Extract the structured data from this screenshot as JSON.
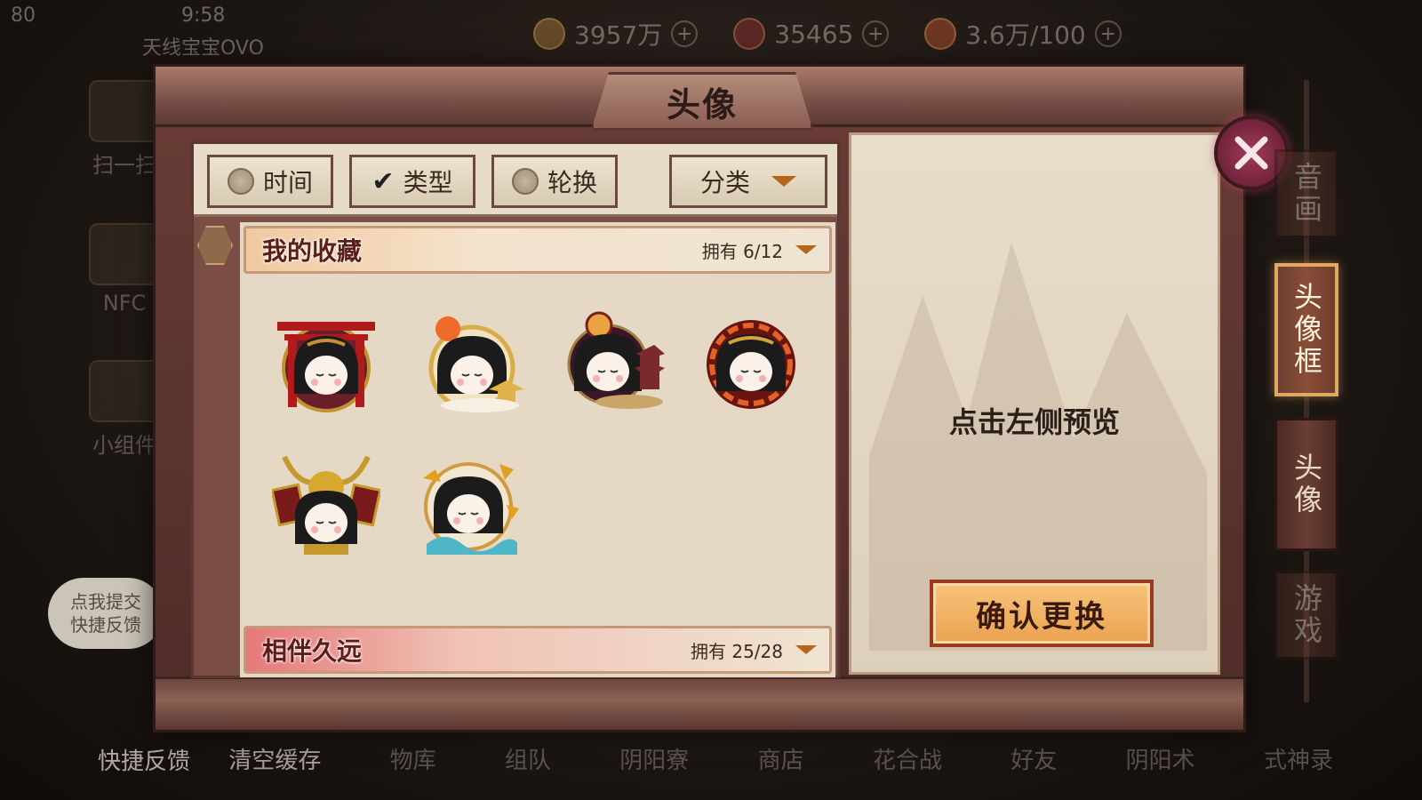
{
  "status_bar": {
    "battery_level": "80",
    "time": "9:58",
    "player_name": "天线宝宝OVO"
  },
  "resources": [
    {
      "icon": "gold-coin-icon",
      "value": "3957万"
    },
    {
      "icon": "magatama-icon",
      "value": "35465"
    },
    {
      "icon": "stamina-icon",
      "value": "3.6万/100"
    }
  ],
  "left_menu": [
    {
      "label": "扫一扫"
    },
    {
      "label": "NFC"
    },
    {
      "label": "小组件"
    }
  ],
  "bottom_nav": [
    "快捷反馈",
    "清空缓存",
    "物库",
    "组队",
    "阴阳寮",
    "商店",
    "花合战",
    "好友",
    "阴阳术",
    "式神录"
  ],
  "feedback_bubble": "点我提交\n快捷反馈",
  "panel": {
    "title": "头像",
    "filters": {
      "time_label": "时间",
      "type_label": "类型",
      "rotate_label": "轮换",
      "category_label": "分类",
      "selected": "类型"
    },
    "sections": [
      {
        "title": "我的收藏",
        "count": "拥有 6/12"
      },
      {
        "title": "相伴久远",
        "count": "拥有 25/28"
      }
    ],
    "preview_hint": "点击左侧预览",
    "confirm_label": "确认更换"
  },
  "side_tabs": [
    {
      "label": "音画",
      "state": "dim"
    },
    {
      "label": "头像框",
      "state": "active"
    },
    {
      "label": "头像",
      "state": "normal"
    },
    {
      "label": "游戏",
      "state": "dim"
    }
  ],
  "avatars": [
    {
      "name": "torii-frame-avatar"
    },
    {
      "name": "golden-temple-frame-avatar"
    },
    {
      "name": "pagoda-moon-frame-avatar"
    },
    {
      "name": "red-dragon-frame-avatar"
    },
    {
      "name": "samurai-helmet-frame-avatar"
    },
    {
      "name": "autumn-wave-frame-avatar"
    }
  ],
  "colors": {
    "panel_wood": "#6a3d36",
    "parchment": "#e5d9c5",
    "confirm_orange": "#eaa250",
    "accent_brown": "#b5651d"
  }
}
